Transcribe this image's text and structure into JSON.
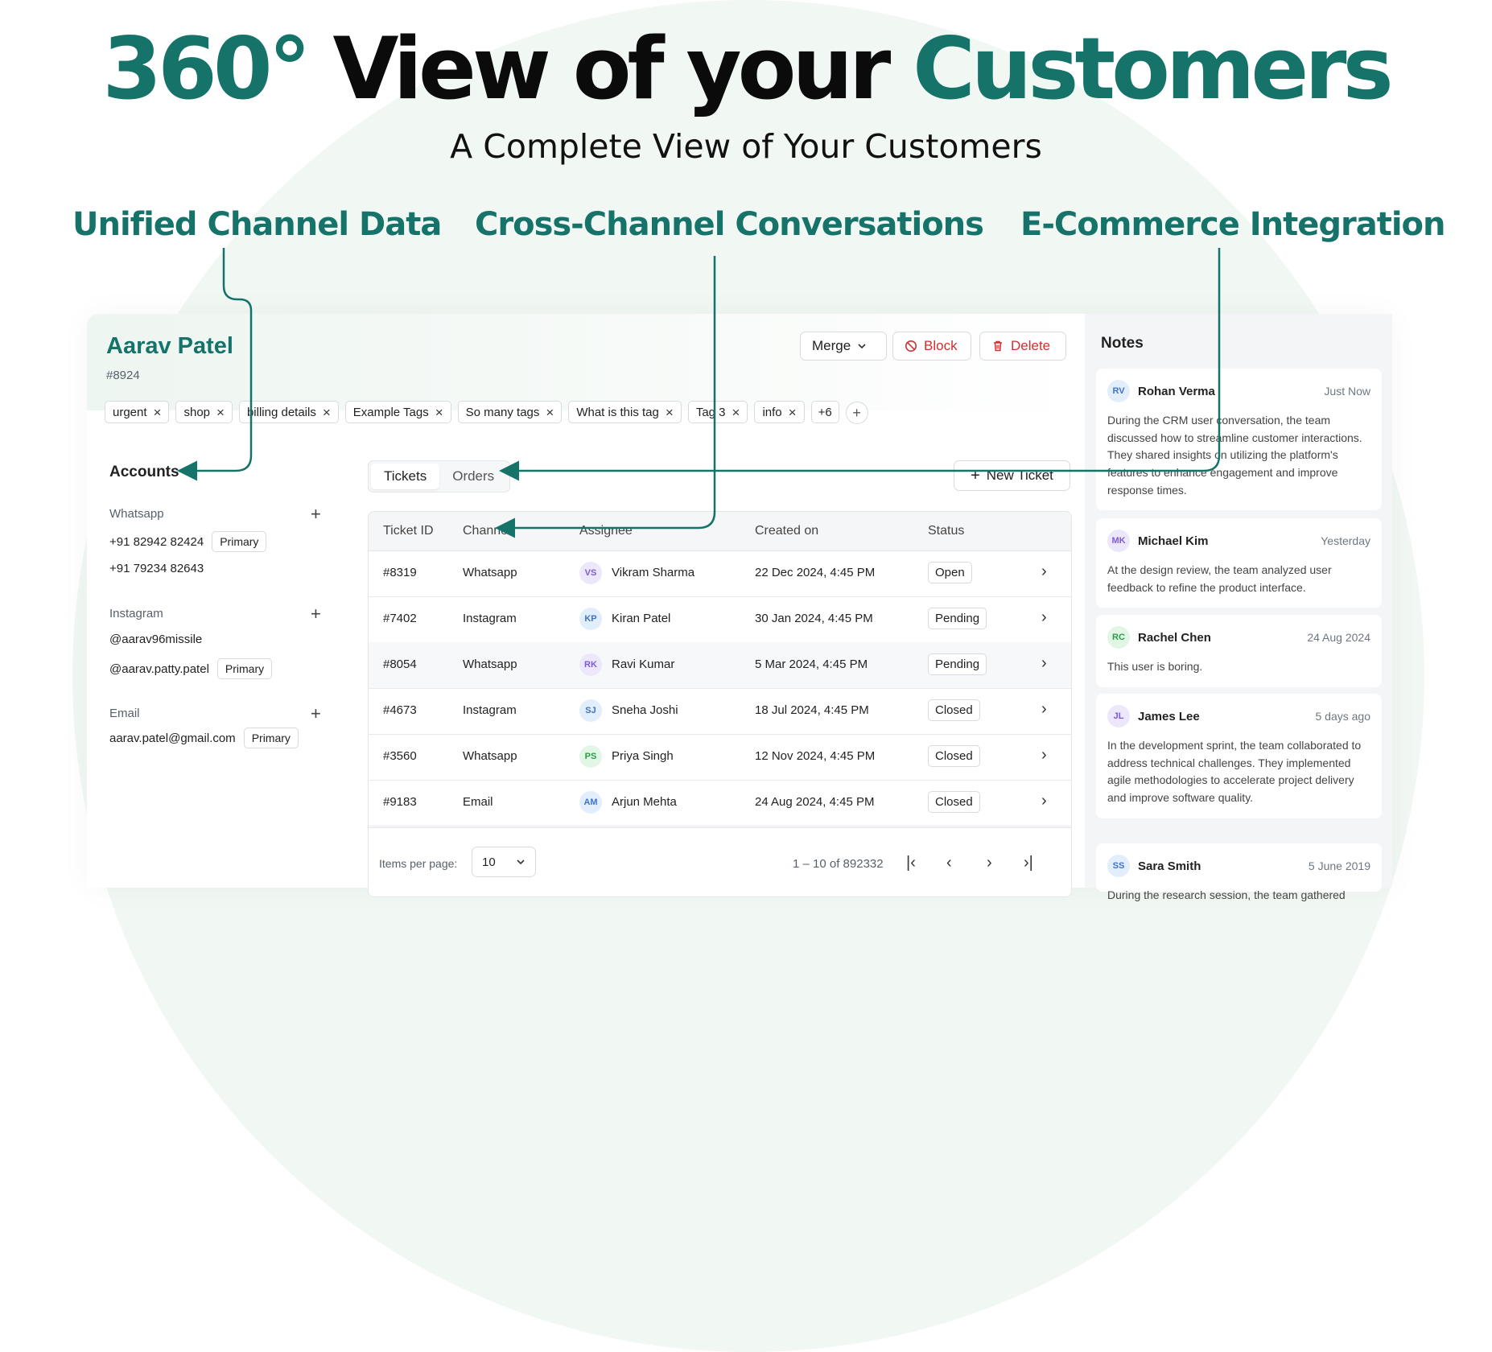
{
  "hero": {
    "title_part1": "360°",
    "title_part2": "View of your",
    "title_part3": "Customers",
    "subtitle": "A Complete View of Your Customers"
  },
  "features": [
    "Unified Channel Data",
    "Cross-Channel Conversations",
    "E-Commerce Integration"
  ],
  "customer": {
    "name": "Aarav Patel",
    "id": "#8924"
  },
  "header_buttons": {
    "merge": "Merge",
    "block": "Block",
    "delete": "Delete"
  },
  "tags": [
    "urgent",
    "shop",
    "billing details",
    "Example Tags",
    "So many tags",
    "What is this tag",
    "Tag 3",
    "info"
  ],
  "tags_more": "+6",
  "accounts": {
    "title": "Accounts",
    "whatsapp": {
      "label": "Whatsapp",
      "items": [
        "+91 82942 82424",
        "+91 79234 82643"
      ],
      "primary": "Primary"
    },
    "instagram": {
      "label": "Instagram",
      "items": [
        "@aarav96missile",
        "@aarav.patty.patel"
      ],
      "primary": "Primary"
    },
    "email": {
      "label": "Email",
      "items": [
        "aarav.patel@gmail.com"
      ],
      "primary": "Primary"
    }
  },
  "tabs": {
    "tickets": "Tickets",
    "orders": "Orders"
  },
  "new_ticket": "New Ticket",
  "table": {
    "headers": [
      "Ticket ID",
      "Channel",
      "Assignee",
      "Created on",
      "Status"
    ],
    "rows": [
      {
        "id": "#8319",
        "channel": "Whatsapp",
        "initials": "VS",
        "assignee": "Vikram Sharma",
        "created": "22 Dec 2024, 4:45 PM",
        "status": "Open"
      },
      {
        "id": "#7402",
        "channel": "Instagram",
        "initials": "KP",
        "assignee": "Kiran Patel",
        "created": "30 Jan 2024, 4:45 PM",
        "status": "Pending"
      },
      {
        "id": "#8054",
        "channel": "Whatsapp",
        "initials": "RK",
        "assignee": "Ravi Kumar",
        "created": "5 Mar 2024, 4:45 PM",
        "status": "Pending"
      },
      {
        "id": "#4673",
        "channel": "Instagram",
        "initials": "SJ",
        "assignee": "Sneha Joshi",
        "created": "18 Jul 2024, 4:45 PM",
        "status": "Closed"
      },
      {
        "id": "#3560",
        "channel": "Whatsapp",
        "initials": "PS",
        "assignee": "Priya Singh",
        "created": "12 Nov 2024, 4:45 PM",
        "status": "Closed"
      },
      {
        "id": "#9183",
        "channel": "Email",
        "initials": "AM",
        "assignee": "Arjun Mehta",
        "created": "24 Aug 2024, 4:45 PM",
        "status": "Closed"
      }
    ]
  },
  "pagination": {
    "items_per_page_label": "Items per page:",
    "items_per_page": "10",
    "range": "1 – 10 of 892332"
  },
  "notes": {
    "title": "Notes",
    "items": [
      {
        "initials": "RV",
        "name": "Rohan Verma",
        "time": "Just Now",
        "body": "During the CRM user conversation, the team discussed how to streamline customer interactions. They shared insights on utilizing the platform's features to enhance engagement and improve response times."
      },
      {
        "initials": "MK",
        "name": "Michael Kim",
        "time": "Yesterday",
        "body": "At the design review, the team analyzed user feedback to refine the product interface."
      },
      {
        "initials": "RC",
        "name": "Rachel Chen",
        "time": "24 Aug 2024",
        "body": "This user is boring."
      },
      {
        "initials": "JL",
        "name": "James Lee",
        "time": "5 days ago",
        "body": "In the development sprint, the team collaborated to address technical challenges. They implemented agile methodologies to accelerate project delivery and improve software quality."
      },
      {
        "initials": "SS",
        "name": "Sara Smith",
        "time": "5 June 2019",
        "body": "During the research session, the team gathered"
      }
    ]
  },
  "colors": {
    "accent": "#15736a",
    "danger": "#d32f2f"
  }
}
